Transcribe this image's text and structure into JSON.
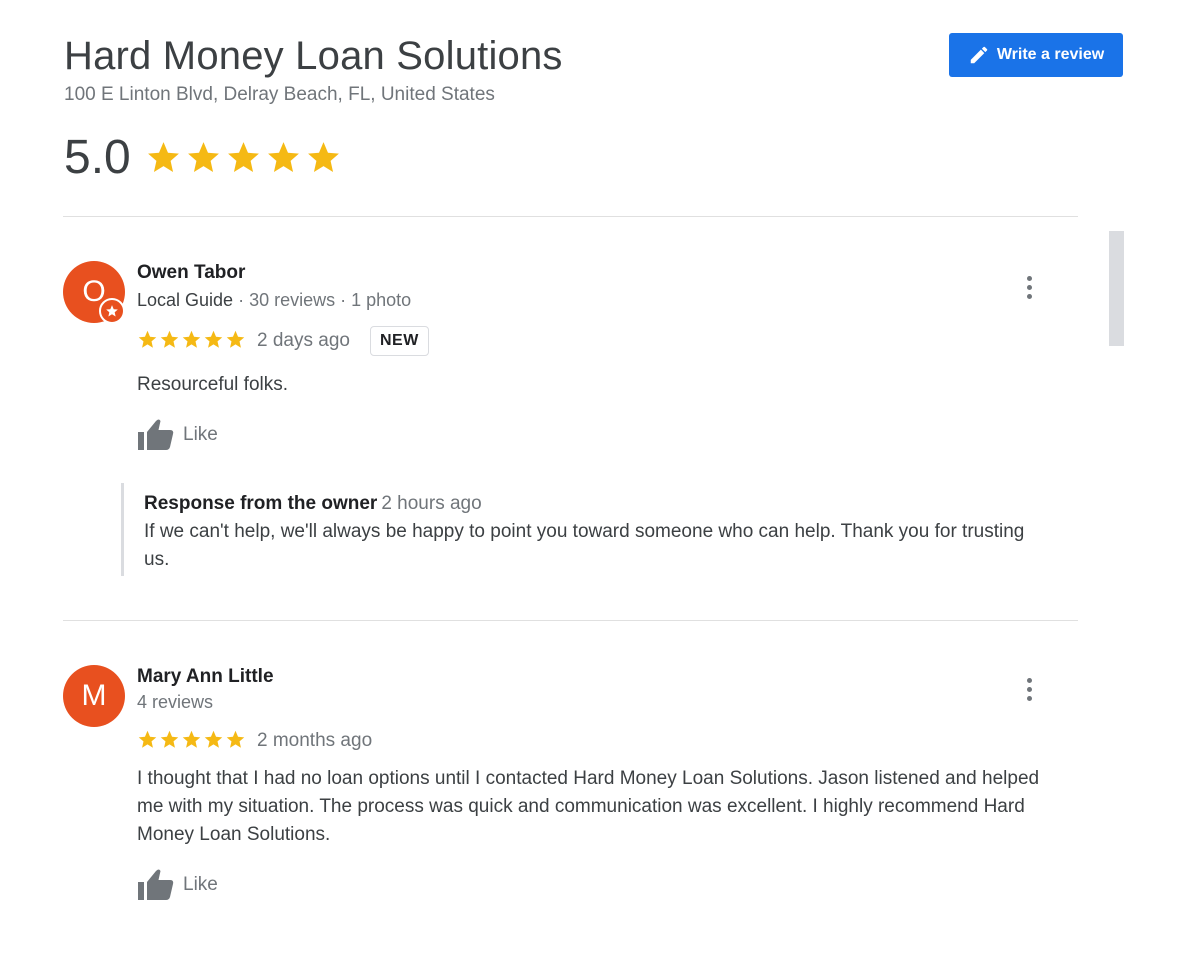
{
  "business": {
    "name": "Hard Money Loan Solutions",
    "address": "100 E Linton Blvd, Delray Beach, FL, United States",
    "rating": "5.0",
    "stars": 5
  },
  "header": {
    "write_review_label": "Write a review",
    "write_review_icon": "pencil-icon"
  },
  "colors": {
    "accent_blue": "#1a73e8",
    "star_yellow": "#f5b914",
    "avatar_orange": "#e8501f"
  },
  "reviews": [
    {
      "initial": "O",
      "name": "Owen Tabor",
      "guide_label": "Local Guide",
      "reviews_count": "30 reviews",
      "photos_count": "1 photo",
      "stars": 5,
      "date": "2 days ago",
      "badge": "NEW",
      "text": "Resourceful folks.",
      "like_label": "Like",
      "owner_response": {
        "label": "Response from the owner",
        "time": "2 hours ago",
        "text": "If we can't help, we'll always be happy to point you toward someone who can help. Thank you for trusting us."
      }
    },
    {
      "initial": "M",
      "name": "Mary Ann Little",
      "reviews_count": "4 reviews",
      "stars": 5,
      "date": "2 months ago",
      "text": "I thought that I had no loan options until I contacted Hard Money Loan Solutions. Jason listened and helped me with my situation. The process was quick and communication was excellent. I highly recommend Hard Money Loan Solutions.",
      "like_label": "Like"
    }
  ]
}
